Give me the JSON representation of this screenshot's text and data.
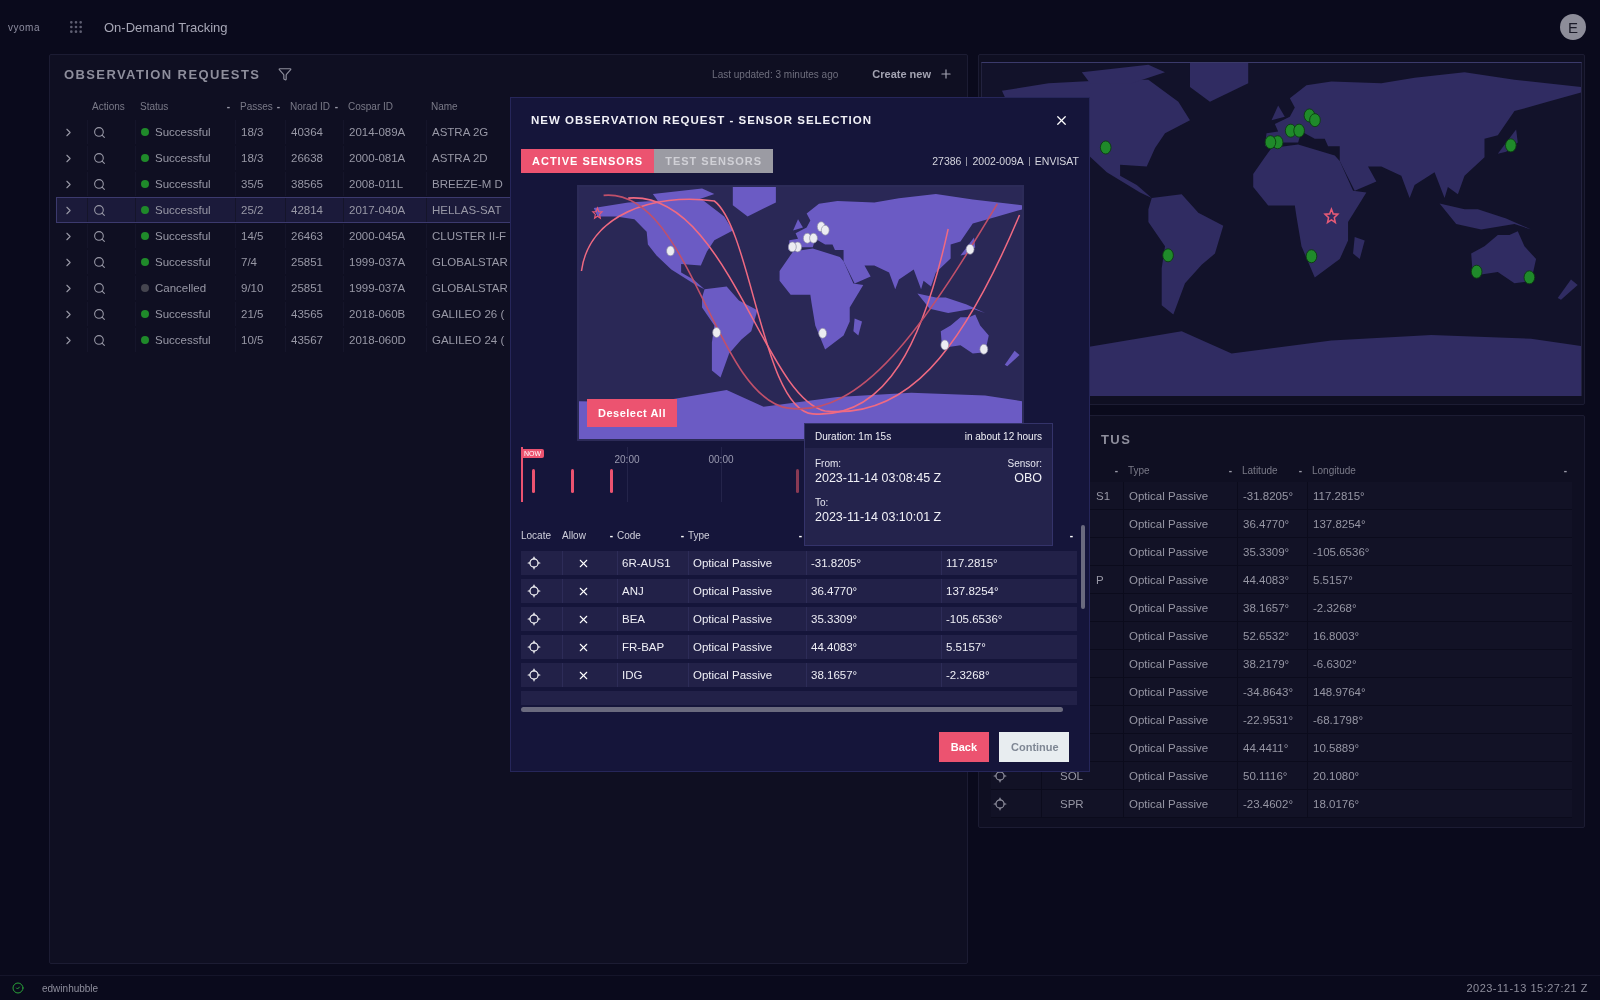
{
  "app": {
    "logo": "vyoma",
    "title": "On-Demand Tracking",
    "avatar": "E"
  },
  "requests": {
    "title": "OBSERVATION REQUESTS",
    "last_updated": "Last updated: 3 minutes ago",
    "create": "Create new",
    "columns": [
      {
        "label": "Actions"
      },
      {
        "label": "Status",
        "sort": "-"
      },
      {
        "label": "Passes",
        "sort": "-"
      },
      {
        "label": "Norad ID",
        "sort": "-"
      },
      {
        "label": "Cospar ID"
      },
      {
        "label": "Name"
      }
    ],
    "rows": [
      {
        "status": "Successful",
        "color": "#1f8a2a",
        "passes": "18/3",
        "norad": "40364",
        "cospar": "2014-089A",
        "name": "ASTRA 2G",
        "selected": false
      },
      {
        "status": "Successful",
        "color": "#1f8a2a",
        "passes": "18/3",
        "norad": "26638",
        "cospar": "2000-081A",
        "name": "ASTRA 2D",
        "selected": false
      },
      {
        "status": "Successful",
        "color": "#1f8a2a",
        "passes": "35/5",
        "norad": "38565",
        "cospar": "2008-011L",
        "name": "BREEZE-M D",
        "selected": false
      },
      {
        "status": "Successful",
        "color": "#1f8a2a",
        "passes": "25/2",
        "norad": "42814",
        "cospar": "2017-040A",
        "name": "HELLAS-SAT",
        "selected": true
      },
      {
        "status": "Successful",
        "color": "#1f8a2a",
        "passes": "14/5",
        "norad": "26463",
        "cospar": "2000-045A",
        "name": "CLUSTER II-F",
        "selected": false
      },
      {
        "status": "Successful",
        "color": "#1f8a2a",
        "passes": "7/4",
        "norad": "25851",
        "cospar": "1999-037A",
        "name": "GLOBALSTAR",
        "selected": false
      },
      {
        "status": "Cancelled",
        "color": "#45454f",
        "passes": "9/10",
        "norad": "25851",
        "cospar": "1999-037A",
        "name": "GLOBALSTAR",
        "selected": false
      },
      {
        "status": "Successful",
        "color": "#1f8a2a",
        "passes": "21/5",
        "norad": "43565",
        "cospar": "2018-060B",
        "name": "GALILEO 26 (",
        "selected": false
      },
      {
        "status": "Successful",
        "color": "#1f8a2a",
        "passes": "10/5",
        "norad": "43567",
        "cospar": "2018-060D",
        "name": "GALILEO 24 (",
        "selected": false
      }
    ]
  },
  "sensors": {
    "title": "TUS",
    "code_sort": "-",
    "columns": [
      {
        "label": "Type",
        "sort": "-"
      },
      {
        "label": "Latitude",
        "sort": "-"
      },
      {
        "label": "Longitude",
        "sort": "-"
      }
    ],
    "rows": [
      {
        "code": "S1",
        "clipped": true,
        "type": "Optical Passive",
        "lat": "-31.8205°",
        "lon": "117.2815°"
      },
      {
        "type": "Optical Passive",
        "lat": "36.4770°",
        "lon": "137.8254°"
      },
      {
        "type": "Optical Passive",
        "lat": "35.3309°",
        "lon": "-105.6536°"
      },
      {
        "code": "P",
        "clipped": true,
        "type": "Optical Passive",
        "lat": "44.4083°",
        "lon": "5.5157°"
      },
      {
        "type": "Optical Passive",
        "lat": "38.1657°",
        "lon": "-2.3268°"
      },
      {
        "type": "Optical Passive",
        "lat": "52.6532°",
        "lon": "16.8003°"
      },
      {
        "type": "Optical Passive",
        "lat": "38.2179°",
        "lon": "-6.6302°"
      },
      {
        "type": "Optical Passive",
        "lat": "-34.8643°",
        "lon": "148.9764°"
      },
      {
        "type": "Optical Passive",
        "lat": "-22.9531°",
        "lon": "-68.1798°"
      },
      {
        "type": "Optical Passive",
        "lat": "44.4411°",
        "lon": "10.5889°"
      },
      {
        "code": "SOL",
        "clipped": false,
        "type": "Optical Passive",
        "lat": "50.1116°",
        "lon": "20.1080°"
      },
      {
        "code": "SPR",
        "clipped": false,
        "type": "Optical Passive",
        "lat": "-23.4602°",
        "lon": "18.0176°"
      }
    ]
  },
  "dialog": {
    "title": "NEW OBSERVATION REQUEST - SENSOR SELECTION",
    "tabs": [
      {
        "label": "ACTIVE SENSORS",
        "selected": true
      },
      {
        "label": "TEST SENSORS",
        "selected": false
      }
    ],
    "object": [
      "27386",
      "2002-009A",
      "ENVISAT"
    ],
    "deselect": "Deselect All",
    "timeline": {
      "now": "NOW",
      "ticks": [
        "20:00",
        "00:00"
      ]
    },
    "tooltip": {
      "duration": "Duration: 1m 15s",
      "eta": "in about 12 hours",
      "from_label": "From:",
      "from": "2023-11-14 03:08:45 Z",
      "sensor_label": "Sensor:",
      "sensor": "OBO",
      "to_label": "To:",
      "to": "2023-11-14 03:10:01 Z"
    },
    "columns": [
      {
        "label": "Locate"
      },
      {
        "label": "Allow",
        "sort": "-"
      },
      {
        "label": "Code",
        "sort": "-"
      },
      {
        "label": "Type",
        "sort": "-"
      },
      {},
      {
        "sort": "-"
      }
    ],
    "rows": [
      {
        "code": "6R-AUS1",
        "type": "Optical Passive",
        "lat": "-31.8205°",
        "lon": "117.2815°"
      },
      {
        "code": "ANJ",
        "type": "Optical Passive",
        "lat": "36.4770°",
        "lon": "137.8254°"
      },
      {
        "code": "BEA",
        "type": "Optical Passive",
        "lat": "35.3309°",
        "lon": "-105.6536°"
      },
      {
        "code": "FR-BAP",
        "type": "Optical Passive",
        "lat": "44.4083°",
        "lon": "5.5157°"
      },
      {
        "code": "IDG",
        "type": "Optical Passive",
        "lat": "38.1657°",
        "lon": "-2.3268°"
      }
    ],
    "back": "Back",
    "continue": {
      "label": "Continue",
      "disabled": true
    }
  },
  "status_bar": {
    "user": "edwinhubble",
    "time": "2023-11-13 15:27:21 Z"
  }
}
